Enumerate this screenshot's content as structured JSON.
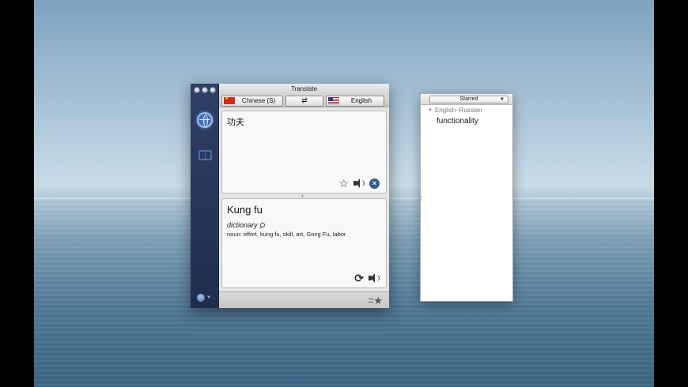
{
  "window": {
    "title": "Translate"
  },
  "languages": {
    "source": "Chinese (S)",
    "target": "English",
    "swap_symbol": "⇄"
  },
  "input": {
    "text": "功夫"
  },
  "output": {
    "title": "Kung fu",
    "dictionary_label": "dictionary",
    "definition": "noun: effort, kung fu, skill, art, Gong Fu, labor"
  },
  "starred_panel": {
    "selector": "Starred",
    "group": "English–Russian",
    "entries": [
      "functionality"
    ]
  },
  "colors": {
    "sidebar": "#2a3a60",
    "accent": "#3a5a8a"
  }
}
